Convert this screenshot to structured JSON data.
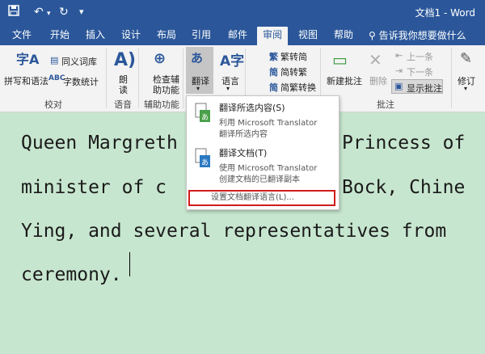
{
  "titlebar": {
    "title": "文档1 - Word",
    "qat": [
      "save-icon",
      "undo-icon",
      "undo-dropdown-icon",
      "redo-icon",
      "customize-qat-icon"
    ]
  },
  "tabs": [
    "文件",
    "开始",
    "插入",
    "设计",
    "布局",
    "引用",
    "邮件",
    "审阅",
    "视图",
    "帮助"
  ],
  "active_tab": "审阅",
  "tell_me": "告诉我你想要做什么",
  "ribbon": {
    "spelling": "拼写和语法",
    "thesaurus": "同义词库",
    "wordcount": "字数统计",
    "group_proofing": "校对",
    "read_aloud": "朗读",
    "group_speech": "语音",
    "check_accessibility": "检查辅助功能",
    "group_accessibility": "辅助功能",
    "translate": "翻译",
    "language": "语言",
    "to_traditional": "繁转简",
    "to_simplified": "简转繁",
    "trad_simp_convert": "简繁转换",
    "new_comment": "新建批注",
    "delete": "删除",
    "previous": "上一条",
    "next": "下一条",
    "show_comments": "显示批注",
    "group_comments": "批注",
    "track_changes": "修订"
  },
  "translate_menu": {
    "item1_title": "翻译所选内容(S)",
    "item1_line1": "利用 Microsoft Translator",
    "item1_line2": "翻译所选内容",
    "item2_title": "翻译文档(T)",
    "item2_line1": "使用 Microsoft Translator",
    "item2_line2": "创建文档的已翻译副本",
    "settings": "设置文档翻译语言(L)..."
  },
  "document": {
    "lines": [
      "Queen Margreth",
      "Princess of",
      "minister of c",
      "Bock, Chine",
      "Ying, and several representatives from",
      "ceremony."
    ]
  }
}
